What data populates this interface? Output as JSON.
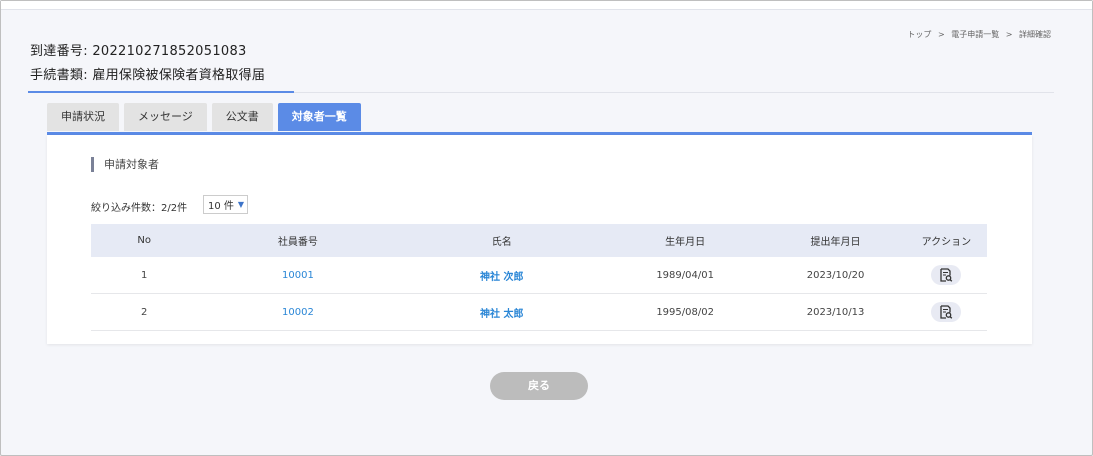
{
  "breadcrumb": {
    "items": [
      "トップ",
      "電子申請一覧",
      "詳細確認"
    ],
    "separator": ">"
  },
  "header": {
    "arrival_label": "到達番号:",
    "arrival_number": "202210271852051083",
    "procedure_label": "手続書類:",
    "procedure_name": "雇用保険被保険者資格取得届"
  },
  "tabs": [
    {
      "label": "申請状況",
      "active": false
    },
    {
      "label": "メッセージ",
      "active": false
    },
    {
      "label": "公文書",
      "active": false
    },
    {
      "label": "対象者一覧",
      "active": true
    }
  ],
  "section": {
    "title": "申請対象者",
    "filter_label": "絞り込み件数：2/2件",
    "page_size": "10 件"
  },
  "table": {
    "columns": [
      "No",
      "社員番号",
      "氏名",
      "生年月日",
      "提出年月日",
      "アクション"
    ],
    "rows": [
      {
        "no": "1",
        "employee_id": "10001",
        "name": "神社 次郎",
        "birth_date": "1989/04/01",
        "submit_date": "2023/10/20"
      },
      {
        "no": "2",
        "employee_id": "10002",
        "name": "神社 太郎",
        "birth_date": "1995/08/02",
        "submit_date": "2023/10/13"
      }
    ]
  },
  "footer": {
    "back_label": "戻る"
  },
  "colors": {
    "accent": "#5b8be6",
    "link": "#2a86d6",
    "header_bg": "#e6eaf5",
    "back_button": "#bcbcbc"
  },
  "icons": {
    "action": "document-search-icon",
    "dropdown": "caret-down-icon"
  }
}
